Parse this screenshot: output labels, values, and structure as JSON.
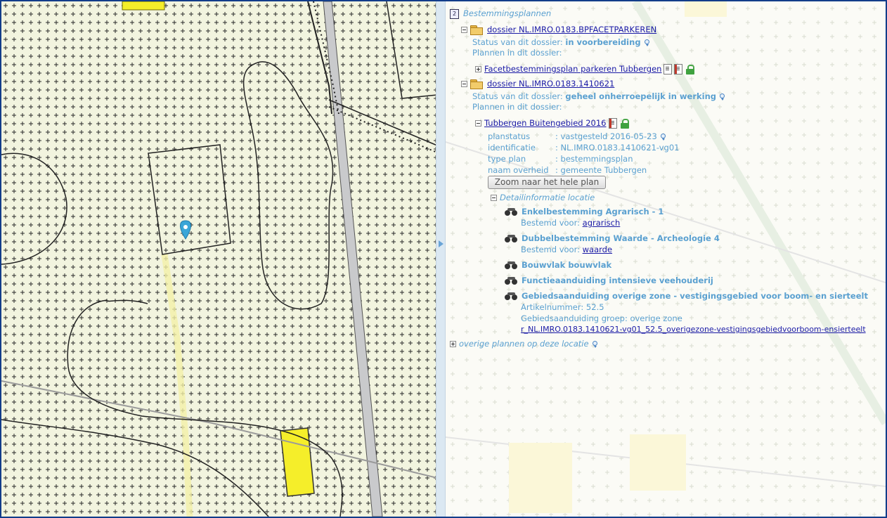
{
  "root": {
    "title": "Bestemmingsplannen",
    "icon": "document-logo-icon"
  },
  "dossiers": [
    {
      "label": "dossier NL.IMRO.0183.BPFACETPARKEREN",
      "status_prefix": "Status van dit dossier:",
      "status": "in voorbereiding",
      "plans_label": "Plannen in dit dossier:",
      "plan": "Facetbestemmingsplan parkeren Tubbergen"
    },
    {
      "label": "dossier NL.IMRO.0183.1410621",
      "status_prefix": "Status van dit dossier:",
      "status": "geheel onherroepelijk in werking",
      "plans_label": "Plannen in dit dossier:",
      "plan": "Tubbergen Buitengebied 2016"
    }
  ],
  "plan_details": {
    "planstatus_label": "planstatus",
    "planstatus_value": ": vastgesteld 2016-05-23",
    "identificatie_label": "identificatie",
    "identificatie_value": ": NL.IMRO.0183.1410621-vg01",
    "typeplan_label": "type plan",
    "typeplan_value": ": bestemmingsplan",
    "overheid_label": "naam overheid",
    "overheid_value": ": gemeente Tubbergen",
    "zoom_button": "Zoom naar het hele plan"
  },
  "detail": {
    "title": "Detailinformatie locatie",
    "items": [
      {
        "title": "Enkelbestemming Agrarisch - 1",
        "sub_prefix": "Bestemd voor:",
        "sub_link": "agrarisch"
      },
      {
        "title": "Dubbelbestemming Waarde - Archeologie 4",
        "sub_prefix": "Bestemd voor:",
        "sub_link": "waarde"
      },
      {
        "title": "Bouwvlak bouwvlak"
      },
      {
        "title": "Functieaanduiding intensieve veehouderij"
      },
      {
        "title": "Gebiedsaanduiding overige zone - vestigingsgebied voor boom- en sierteelt",
        "line1": "Artikelnummer: 52.5",
        "line2": "Gebiedsaanduiding groep: overige zone",
        "link": "r_NL.IMRO.0183.1410621-vg01_52.5_overigezone-vestigingsgebiedvoorboom-ensierteelt"
      }
    ]
  },
  "other_plans": "overige plannen op deze locatie",
  "colors": {
    "border": "#123d8a",
    "accent_text": "#5aa0d0",
    "link": "#1a1aa6",
    "map_bg": "#f3f5e6",
    "highlight_yellow": "#f5ee2a",
    "marker": "#3aa6d8"
  }
}
